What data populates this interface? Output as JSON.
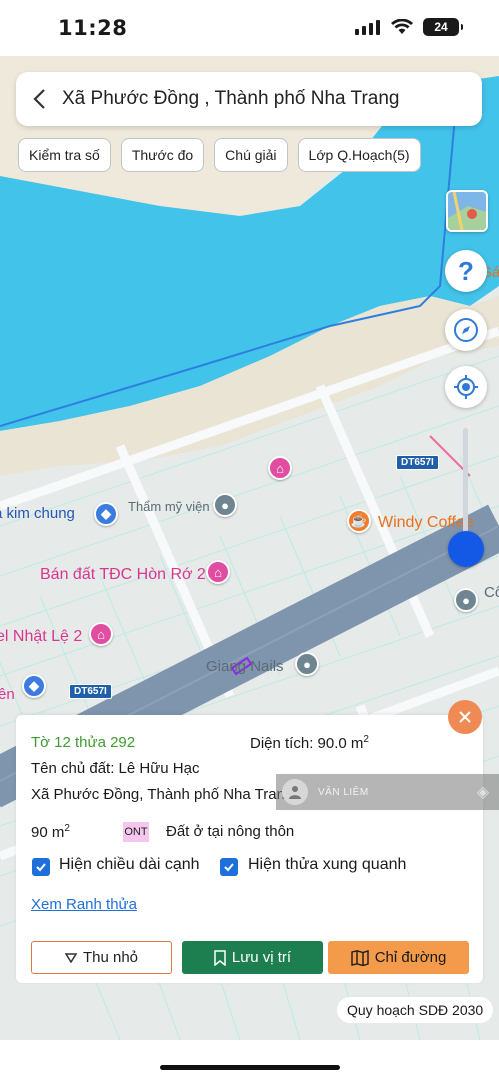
{
  "status_bar": {
    "time": "11:28",
    "battery": "24"
  },
  "header": {
    "title": "Xã Phước Đồng , Thành phố Nha Trang"
  },
  "chips": [
    {
      "label": "Kiểm tra số"
    },
    {
      "label": "Thước đo"
    },
    {
      "label": "Chú giải"
    },
    {
      "label": "Lớp Q.Hoạch(5)"
    }
  ],
  "map": {
    "labels": {
      "tham_my_vien": "Thẩm mỹ viện",
      "kim_chung": "a kim chung",
      "windy_coffee": "Windy Coffee",
      "ban_dat": "Bán đất TĐC Hòn Rớ 2",
      "nhat_le": "el Nhật Lệ 2",
      "giang_nails": "Giang Nails",
      "road_1": "DT657I",
      "road_2": "DT657I",
      "edge_sa": "Sá",
      "edge_co": "Cô",
      "edge_en": "ên"
    }
  },
  "controls": {
    "help_label": "?"
  },
  "panel": {
    "parcel": "Tờ 12 thửa 292",
    "area_label": "Diện tích: 90.0 m",
    "area_unit_sup": "2",
    "owner": "Tên chủ đất: Lê Hữu Hạc",
    "address": "Xã Phước Đồng, Thành phố Nha Trang",
    "size_value": "90 m",
    "size_unit_sup": "2",
    "land_code": "ONT",
    "land_type": "Đất ở tại nông thôn",
    "checkbox_edges": "Hiện chiều dài cạnh",
    "checkbox_neighbors": "Hiện thửa xung quanh",
    "link_boundary": "Xem Ranh thửa",
    "btn_shrink": "Thu nhỏ",
    "btn_save": "Lưu vị trí",
    "btn_route": "Chỉ đường",
    "watermark_name": "VĂN LIÊM"
  },
  "plan_badge": "Quy hoạch SDĐ 2030",
  "colors": {
    "water": "#42c3ea",
    "sand": "#efe9dc",
    "land": "#e6ebe9",
    "highway": "#7f94ad",
    "accent_blue": "#1458e6",
    "save_green": "#1d7e4f",
    "route_orange": "#f39b4a",
    "close_orange": "#f08a55",
    "parcel_green": "#3e9b2e"
  }
}
